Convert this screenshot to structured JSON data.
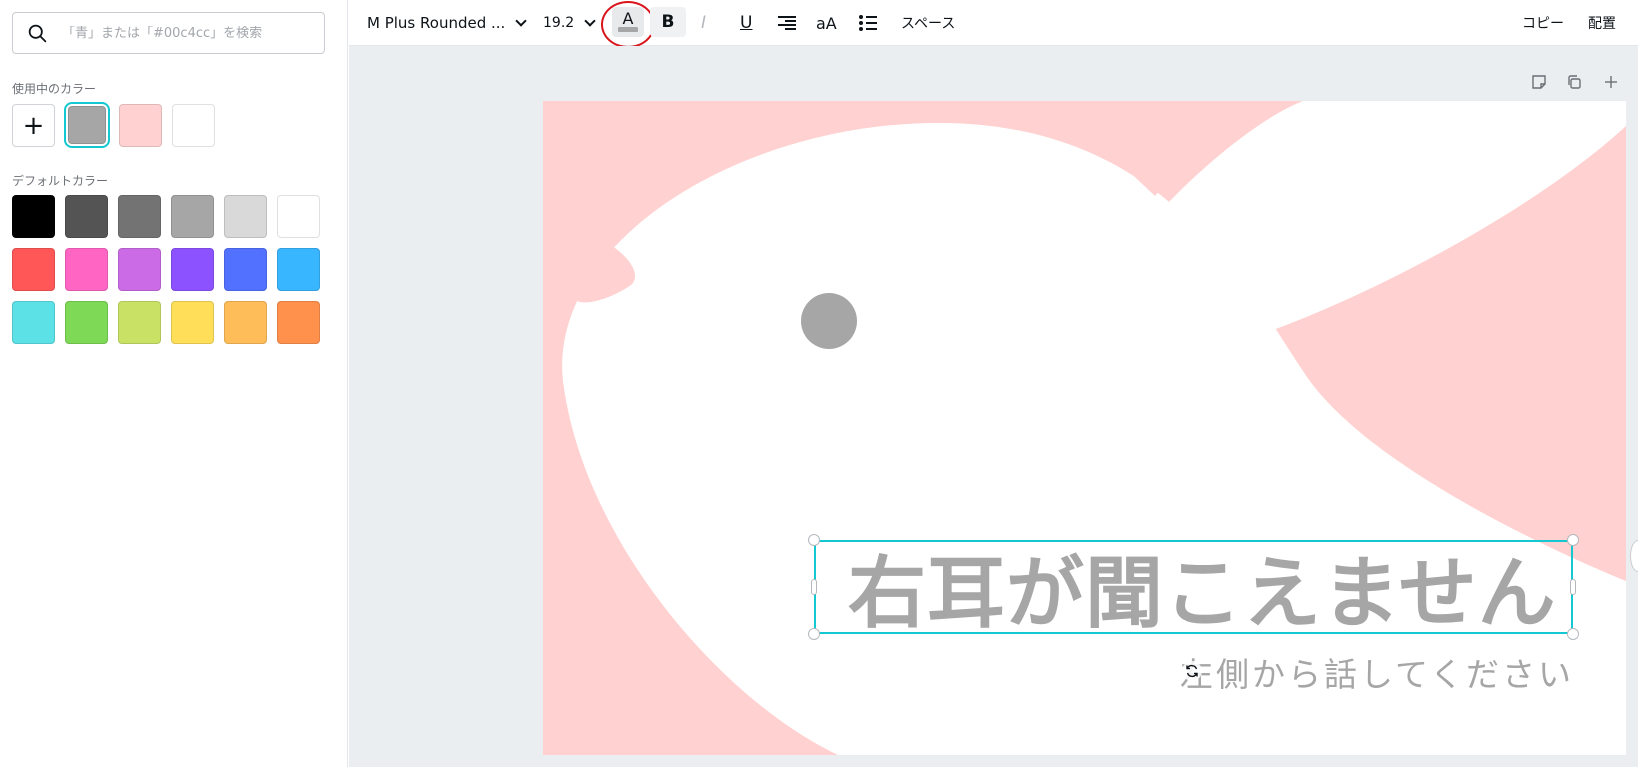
{
  "search": {
    "placeholder": "「青」または「#00c4cc」を検索"
  },
  "panel": {
    "in_use_label": "使用中のカラー",
    "in_use_colors": [
      "#a6a6a6",
      "#ffd1d1",
      "#ffffff"
    ],
    "selected_color": "#a6a6a6",
    "default_label": "デフォルトカラー",
    "default_colors": [
      [
        "#000000",
        "#545454",
        "#737373",
        "#a6a6a6",
        "#d9d9d9",
        "#ffffff"
      ],
      [
        "#ff5757",
        "#ff66c4",
        "#cb6ce6",
        "#8c52ff",
        "#5271ff",
        "#38b6ff"
      ],
      [
        "#5ce1e6",
        "#7ed957",
        "#c9e265",
        "#ffde59",
        "#ffbd59",
        "#ff914d"
      ]
    ]
  },
  "toolbar": {
    "font_name": "M Plus Rounded ...",
    "font_size": "19.2",
    "text_color_letter": "A",
    "text_color": "#a6a6a6",
    "bold_label": "B",
    "italic_label": "I",
    "underline_label": "U",
    "case_label": "aA",
    "spacing_label": "スペース",
    "copy_label": "コピー",
    "arrange_label": "配置",
    "highlight_annotation_color": "#d8141a"
  },
  "canvas": {
    "background_color": "#ffd1d1",
    "shape_color": "#ffffff",
    "eye_color": "#a6a6a6",
    "headline": "右耳が聞こえません",
    "subline": "左側から話してください",
    "selection_color": "#13c8d1"
  },
  "page_tools": [
    "note-icon",
    "duplicate-page-icon",
    "add-page-icon"
  ]
}
